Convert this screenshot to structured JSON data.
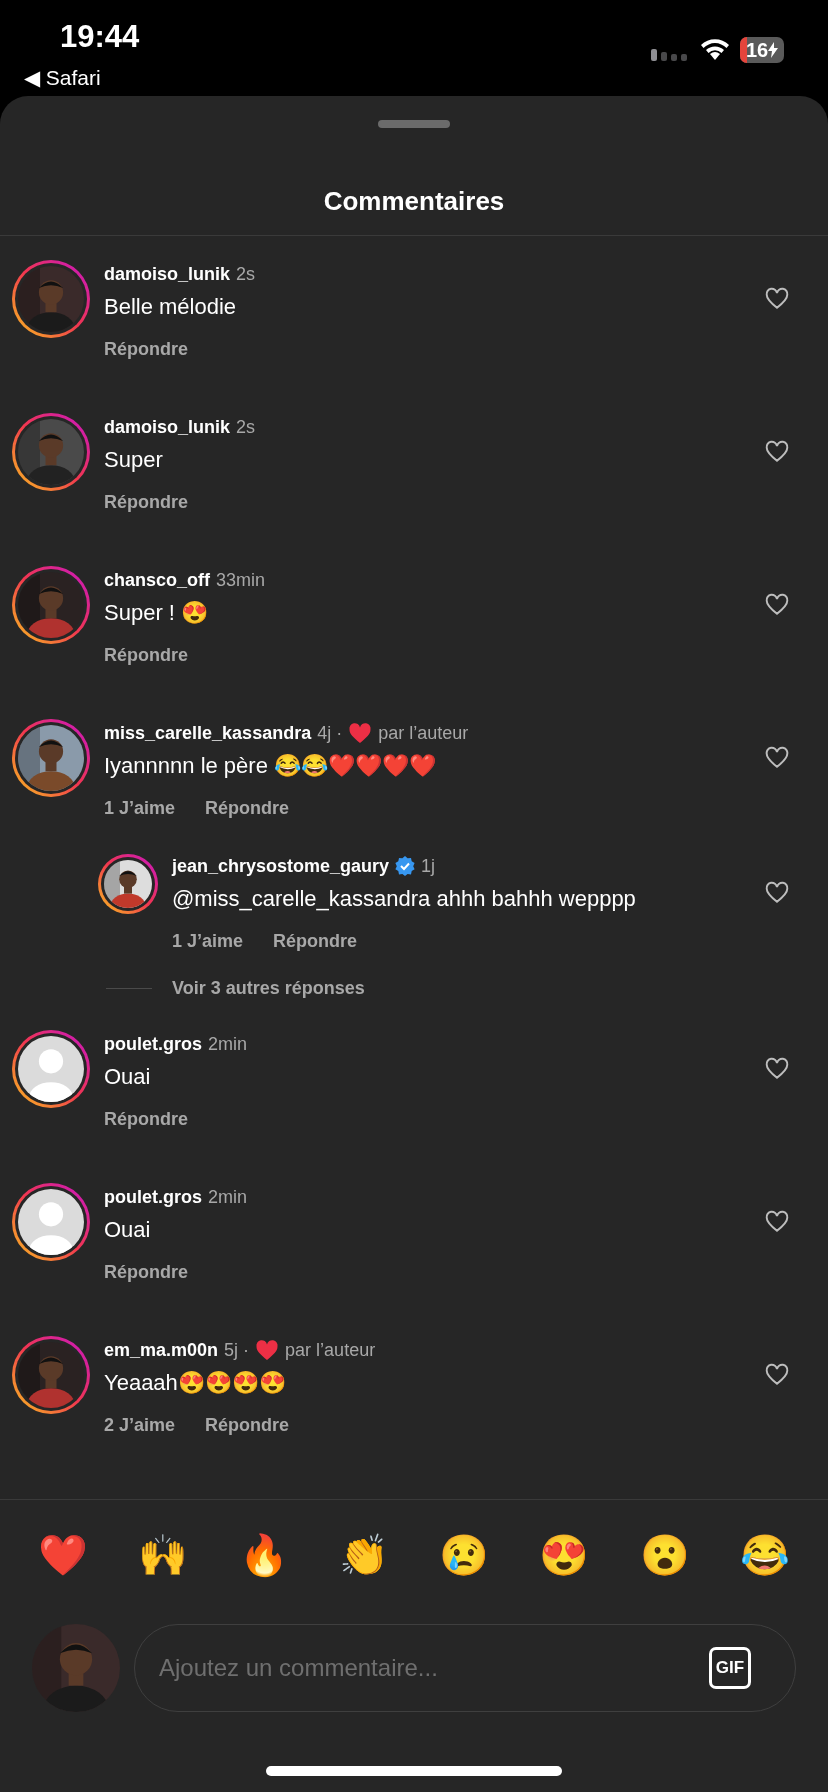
{
  "status_bar": {
    "time": "19:44",
    "back_label": "◀ Safari",
    "battery": "16"
  },
  "sheet": {
    "title": "Commentaires"
  },
  "comments": [
    {
      "username": "damoiso_lunik",
      "verified": false,
      "time": "2s",
      "liked_by_author": false,
      "text": "Belle mélodie",
      "actions": [
        "Répondre"
      ],
      "liked": false
    },
    {
      "username": "damoiso_lunik",
      "verified": false,
      "time": "2s",
      "liked_by_author": false,
      "text": "Super",
      "actions": [
        "Répondre"
      ],
      "liked": false
    },
    {
      "username": "chansco_off",
      "verified": false,
      "time": "33min",
      "liked_by_author": false,
      "text": "Super ! 😍",
      "actions": [
        "Répondre"
      ],
      "liked": false
    },
    {
      "username": "miss_carelle_kassandra",
      "verified": false,
      "time": "4j ·",
      "liked_by_author": true,
      "author_label": "par l’auteur",
      "text": "Iyannnnn le père 😂😂❤️❤️❤️❤️",
      "actions": [
        "1 J’aime",
        "Répondre"
      ],
      "liked": false,
      "children": [
        {
          "username": "jean_chrysostome_gaury",
          "verified": true,
          "time": "1j",
          "liked_by_author": false,
          "text": "@miss_carelle_kassandra ahhh bahhh wepppp",
          "actions": [
            "1 J’aime",
            "Répondre"
          ],
          "liked": false
        }
      ],
      "more_replies": "Voir 3 autres réponses"
    },
    {
      "kind": "default",
      "username": "poulet.gros",
      "verified": false,
      "time": "2min",
      "liked_by_author": false,
      "text": "Ouai",
      "actions": [
        "Répondre"
      ],
      "liked": false
    },
    {
      "kind": "default",
      "username": "poulet.gros",
      "verified": false,
      "time": "2min",
      "liked_by_author": false,
      "text": "Ouai",
      "actions": [
        "Répondre"
      ],
      "liked": false
    },
    {
      "username": "em_ma.m00n",
      "verified": false,
      "time": "5j ·",
      "liked_by_author": true,
      "author_label": "par l’auteur",
      "text": "Yeaaah😍😍😍😍",
      "actions": [
        "2 J’aime",
        "Répondre"
      ],
      "liked": false
    }
  ],
  "quick_reactions": [
    "❤️",
    "🙌",
    "🔥",
    "👏",
    "😢",
    "😍",
    "😮",
    "😂"
  ],
  "composer": {
    "placeholder": "Ajoutez un commentaire...",
    "gif_label": "GIF"
  }
}
